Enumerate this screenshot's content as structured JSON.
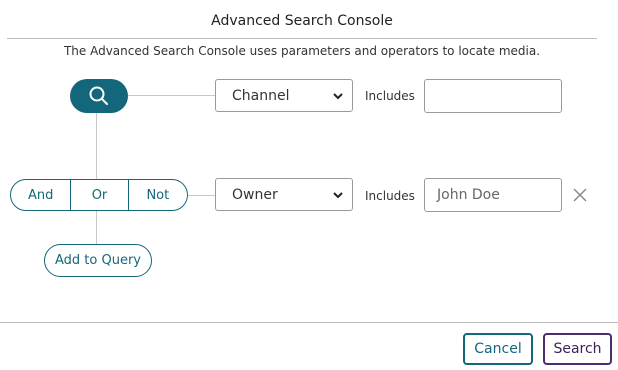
{
  "dialog": {
    "title": "Advanced Search Console",
    "description": "The Advanced Search Console uses parameters and operators to locate media."
  },
  "search_node": {
    "icon": "search-icon"
  },
  "rows": [
    {
      "field": "Channel",
      "operator": "Includes",
      "value": "",
      "placeholder": ""
    },
    {
      "field": "Owner",
      "operator": "Includes",
      "value": "",
      "placeholder": "John Doe",
      "remove_icon": "close-icon"
    }
  ],
  "logic": {
    "and_label": "And",
    "or_label": "Or",
    "not_label": "Not"
  },
  "add_query_label": "Add to Query",
  "footer": {
    "cancel_label": "Cancel",
    "search_label": "Search"
  },
  "colors": {
    "primary": "#14677a",
    "search_button_border": "#4b2c6e"
  }
}
